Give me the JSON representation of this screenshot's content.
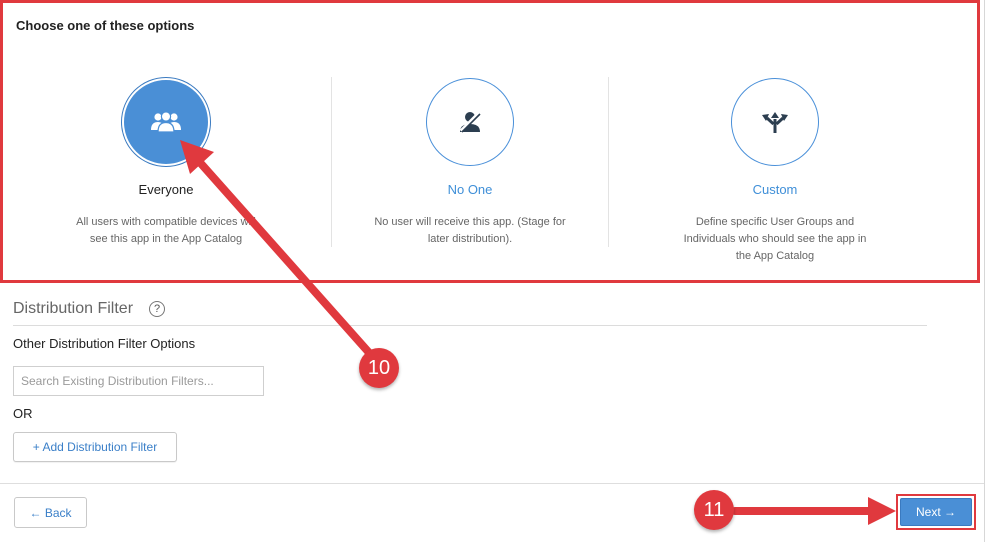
{
  "section": {
    "title": "Choose one of these options"
  },
  "options": [
    {
      "name": "Everyone",
      "description": "All users with compatible devices will see this app in the App Catalog",
      "icon": "users-group-icon",
      "selected": true
    },
    {
      "name": "No One",
      "description": "No user will receive this app. (Stage for later distribution).",
      "icon": "user-slash-icon",
      "selected": false
    },
    {
      "name": "Custom",
      "description": "Define specific User Groups and Individuals who should see the app in the App Catalog",
      "icon": "split-arrows-icon",
      "selected": false
    }
  ],
  "filter": {
    "title": "Distribution Filter",
    "help_glyph": "?",
    "other_label": "Other Distribution Filter Options",
    "search_placeholder": "Search Existing Distribution Filters...",
    "or_label": "OR",
    "add_label": "+ Add Distribution Filter"
  },
  "footer": {
    "back_label": "← Back",
    "next_label": "Next →"
  },
  "annotations": [
    {
      "number": "10"
    },
    {
      "number": "11"
    }
  ],
  "colors": {
    "accent": "#4a8fd6",
    "annotation": "#e0393e"
  }
}
